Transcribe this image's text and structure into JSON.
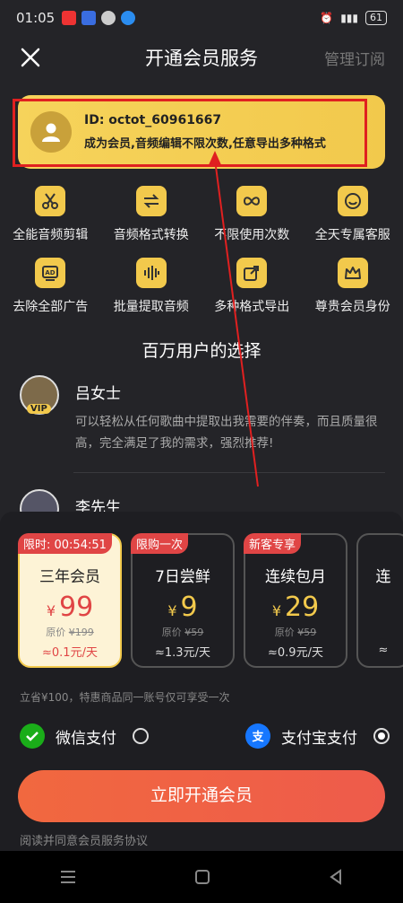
{
  "status_bar": {
    "time": "01:05",
    "battery": "61"
  },
  "nav": {
    "title": "开通会员服务",
    "manage_label": "管理订阅"
  },
  "member_card": {
    "user_id": "ID: octot_60961667",
    "description": "成为会员,音频编辑不限次数,任意导出多种格式"
  },
  "features": [
    {
      "icon": "scissors-icon",
      "label": "全能音频剪辑"
    },
    {
      "icon": "convert-icon",
      "label": "音频格式转换"
    },
    {
      "icon": "infinity-icon",
      "label": "不限使用次数"
    },
    {
      "icon": "customer-service-icon",
      "label": "全天专属客服"
    },
    {
      "icon": "ad-icon",
      "label": "去除全部广告"
    },
    {
      "icon": "waveform-icon",
      "label": "批量提取音频"
    },
    {
      "icon": "export-icon",
      "label": "多种格式导出"
    },
    {
      "icon": "crown-icon",
      "label": "尊贵会员身份"
    }
  ],
  "section_title": "百万用户的选择",
  "reviews": [
    {
      "name": "吕女士",
      "badge": "VIP",
      "text": "可以轻松从任何歌曲中提取出我需要的伴奏，而且质量很高，完全满足了我的需求，强烈推荐!"
    },
    {
      "name": "李先生",
      "badge": "",
      "text": ""
    }
  ],
  "plans": [
    {
      "tag": "限时: 00:54:51",
      "name": "三年会员",
      "currency": "¥",
      "price": "99",
      "orig_label": "原价",
      "orig_price": "¥199",
      "per": "≈0.1元/天",
      "selected": true
    },
    {
      "tag": "限购一次",
      "name": "7日尝鲜",
      "currency": "¥",
      "price": "9",
      "orig_label": "原价",
      "orig_price": "¥59",
      "per": "≈1.3元/天",
      "selected": false
    },
    {
      "tag": "新客专享",
      "name": "连续包月",
      "currency": "¥",
      "price": "29",
      "orig_label": "原价",
      "orig_price": "¥59",
      "per": "≈0.9元/天",
      "selected": false
    },
    {
      "tag": "",
      "name": "连",
      "currency": "",
      "price": "",
      "orig_label": "",
      "orig_price": "",
      "per": "≈",
      "selected": false
    }
  ],
  "note": "立省¥100，特惠商品同一账号仅可享受一次",
  "payment": {
    "wechat_label": "微信支付",
    "alipay_label": "支付宝支付",
    "selected": "alipay"
  },
  "cta_label": "立即开通会员",
  "agreement": "阅读并同意会员服务协议",
  "colors": {
    "accent_gold": "#f2c94c",
    "cta_orange": "#f1683f",
    "tag_red": "#e04545",
    "wechat_green": "#1aad19",
    "alipay_blue": "#1677ff"
  }
}
